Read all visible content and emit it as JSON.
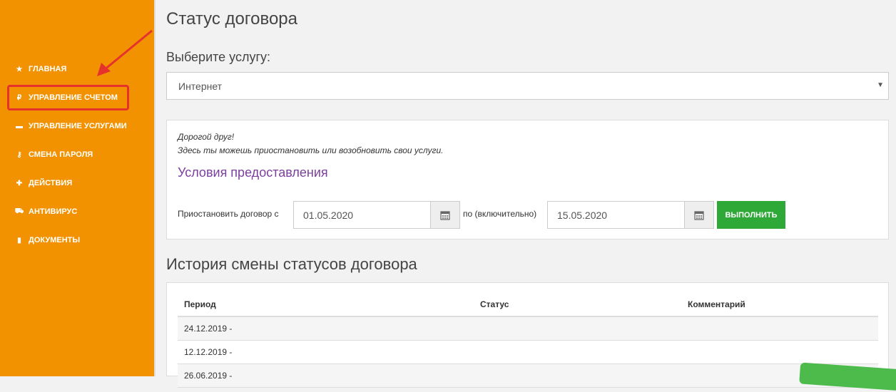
{
  "sidebar": {
    "items": [
      {
        "label": "ГЛАВНАЯ",
        "icon": "star-icon",
        "glyph": "★"
      },
      {
        "label": "УПРАВЛЕНИЕ СЧЕТОМ",
        "icon": "ruble-icon",
        "glyph": "₽"
      },
      {
        "label": "УПРАВЛЕНИЕ УСЛУГАМИ",
        "icon": "briefcase-icon",
        "glyph": "▬"
      },
      {
        "label": "СМЕНА ПАРОЛЯ",
        "icon": "key-icon",
        "glyph": "⚷"
      },
      {
        "label": "ДЕЙСТВИЯ",
        "icon": "plus-icon",
        "glyph": "✚"
      },
      {
        "label": "АНТИВИРУС",
        "icon": "cart-icon",
        "glyph": "⛟"
      },
      {
        "label": "ДОКУМЕНТЫ",
        "icon": "document-icon",
        "glyph": "▮"
      }
    ]
  },
  "main": {
    "title": "Статус договора",
    "select_label": "Выберите услугу:",
    "select_value": "Интернет",
    "panel": {
      "note_line1": "Дорогой друг!",
      "note_line2": "Здесь ты можешь приостановить или возобновить свои услуги.",
      "conditions_link": "Условия предоставления",
      "from_label": "Приостановить договор с",
      "from_date": "01.05.2020",
      "to_label": "по (включительно)",
      "to_date": "15.05.2020",
      "submit_label": "ВЫПОЛНИТЬ"
    },
    "history": {
      "title": "История смены статусов договора",
      "columns": [
        "Период",
        "Статус",
        "Комментарий"
      ],
      "rows": [
        "24.12.2019 -",
        "12.12.2019 -",
        "26.06.2019 -"
      ]
    }
  },
  "colors": {
    "sidebar_bg": "#f39200",
    "accent_green": "#2ea836",
    "link_purple": "#7b3f9e",
    "highlight_red": "#e5322d"
  }
}
